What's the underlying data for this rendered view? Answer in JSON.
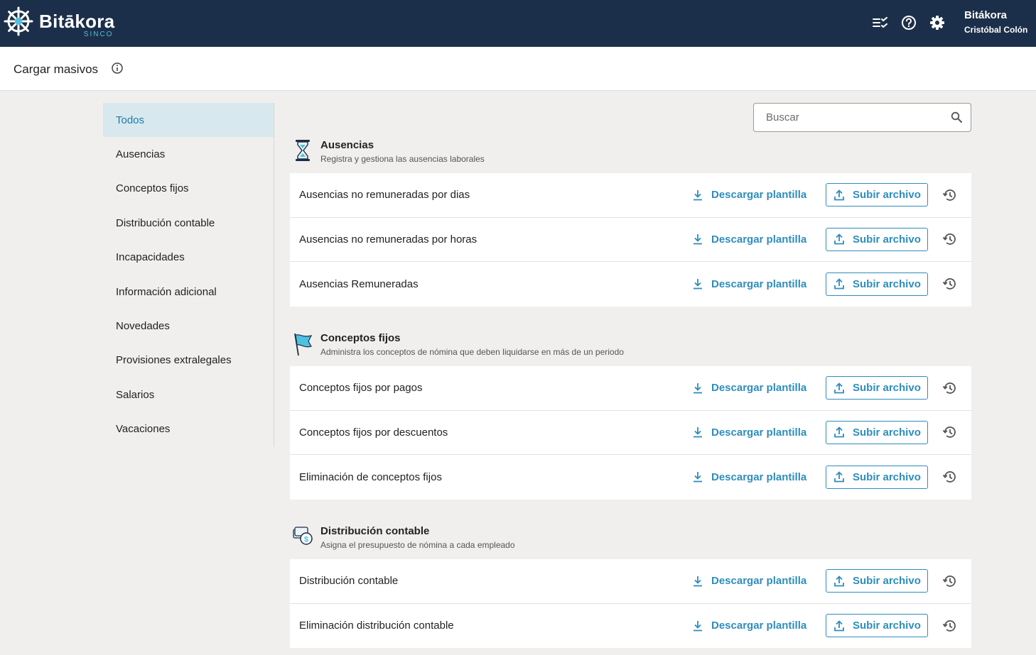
{
  "app": {
    "logo_title": "Bitākora",
    "logo_subtitle": "SINCO",
    "org": "Bitákora",
    "user": "Cristóbal Colón",
    "icons": [
      "checklist-icon",
      "help-icon",
      "gear-icon"
    ]
  },
  "page": {
    "title": "Cargar masivos"
  },
  "sidebar": {
    "items": [
      {
        "label": "Todos",
        "active": true
      },
      {
        "label": "Ausencias"
      },
      {
        "label": "Conceptos fijos"
      },
      {
        "label": "Distribución contable"
      },
      {
        "label": "Incapacidades"
      },
      {
        "label": "Información adicional"
      },
      {
        "label": "Novedades"
      },
      {
        "label": "Provisiones extralegales"
      },
      {
        "label": "Salarios"
      },
      {
        "label": "Vacaciones"
      }
    ]
  },
  "search": {
    "placeholder": "Buscar"
  },
  "actions": {
    "download": "Descargar plantilla",
    "upload": "Subir archivo"
  },
  "sections": [
    {
      "title": "Ausencias",
      "description": "Registra y gestiona las ausencias laborales",
      "icon": "hourglass-icon",
      "rows": [
        "Ausencias no remuneradas por dias",
        "Ausencias no remuneradas por horas",
        "Ausencias Remuneradas"
      ]
    },
    {
      "title": "Conceptos fijos",
      "description": "Administra los conceptos de nómina que deben liquidarse en más de un periodo",
      "icon": "flag-icon",
      "rows": [
        "Conceptos fijos por pagos",
        "Conceptos fijos por descuentos",
        "Eliminación de conceptos fijos"
      ]
    },
    {
      "title": "Distribución contable",
      "description": "Asigna el presupuesto de nómina a cada empleado",
      "icon": "budget-icon",
      "rows": [
        "Distribución contable",
        "Eliminación distribución contable"
      ]
    }
  ],
  "colors": {
    "topbar": "#1c2f4a",
    "accent": "#2e8dbd",
    "active_bg": "#d8e8ef"
  }
}
